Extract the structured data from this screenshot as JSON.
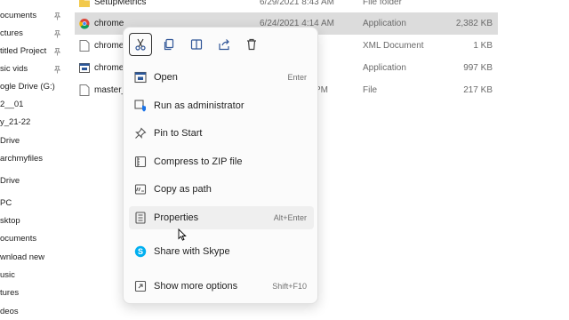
{
  "nav": {
    "items": [
      {
        "label": "ocuments",
        "pinned": true
      },
      {
        "label": "ctures",
        "pinned": true
      },
      {
        "label": "titled Project",
        "pinned": true
      },
      {
        "label": "sic vids",
        "pinned": true
      },
      {
        "label": "ogle Drive (G:)",
        "pinned": true
      },
      {
        "label": "2__01",
        "pinned": false
      },
      {
        "label": "y_21-22",
        "pinned": false
      },
      {
        "label": "Drive",
        "pinned": false
      },
      {
        "label": "archmyfiles",
        "pinned": false
      },
      {
        "label": "Drive",
        "pinned": false
      },
      {
        "label": "PC",
        "pinned": false
      },
      {
        "label": "sktop",
        "pinned": false
      },
      {
        "label": "ocuments",
        "pinned": false
      },
      {
        "label": "wnload new",
        "pinned": false
      },
      {
        "label": "usic",
        "pinned": false
      },
      {
        "label": "tures",
        "pinned": false
      },
      {
        "label": "deos",
        "pinned": false
      }
    ]
  },
  "files": [
    {
      "name": "SetupMetrics",
      "date": "6/29/2021 8:43 AM",
      "type": "File folder",
      "size": "",
      "icon": "folder-icon"
    },
    {
      "name": "chrome",
      "date": "6/24/2021 4:14 AM",
      "type": "Application",
      "size": "2,382 KB",
      "icon": "chrome-icon"
    },
    {
      "name": "chrome.",
      "date": "",
      "type": "XML Document",
      "size": "1 KB",
      "icon": "document-icon"
    },
    {
      "name": "chrome_",
      "date": "",
      "type": "Application",
      "size": "997 KB",
      "icon": "application-icon"
    },
    {
      "name": "master_",
      "date": "PM",
      "type": "File",
      "size": "217 KB",
      "icon": "document-icon"
    }
  ],
  "context_menu": {
    "toolbar": [
      "cut-icon",
      "copy-icon",
      "rename-icon",
      "share-icon",
      "delete-icon"
    ],
    "items": [
      {
        "label": "Open",
        "shortcut": "Enter",
        "icon": "open-icon"
      },
      {
        "label": "Run as administrator",
        "shortcut": "",
        "icon": "admin-shield-icon"
      },
      {
        "label": "Pin to Start",
        "shortcut": "",
        "icon": "pin-icon"
      },
      {
        "label": "Compress to ZIP file",
        "shortcut": "",
        "icon": "zip-icon"
      },
      {
        "label": "Copy as path",
        "shortcut": "",
        "icon": "copy-path-icon"
      },
      {
        "label": "Properties",
        "shortcut": "Alt+Enter",
        "icon": "properties-icon"
      },
      {
        "label": "Share with Skype",
        "shortcut": "",
        "icon": "skype-icon"
      },
      {
        "label": "Show more options",
        "shortcut": "Shift+F10",
        "icon": "more-options-icon"
      }
    ]
  },
  "colors": {
    "selection": "#dcdcdc",
    "accent": "#1a73e8",
    "skype": "#00aff0"
  }
}
